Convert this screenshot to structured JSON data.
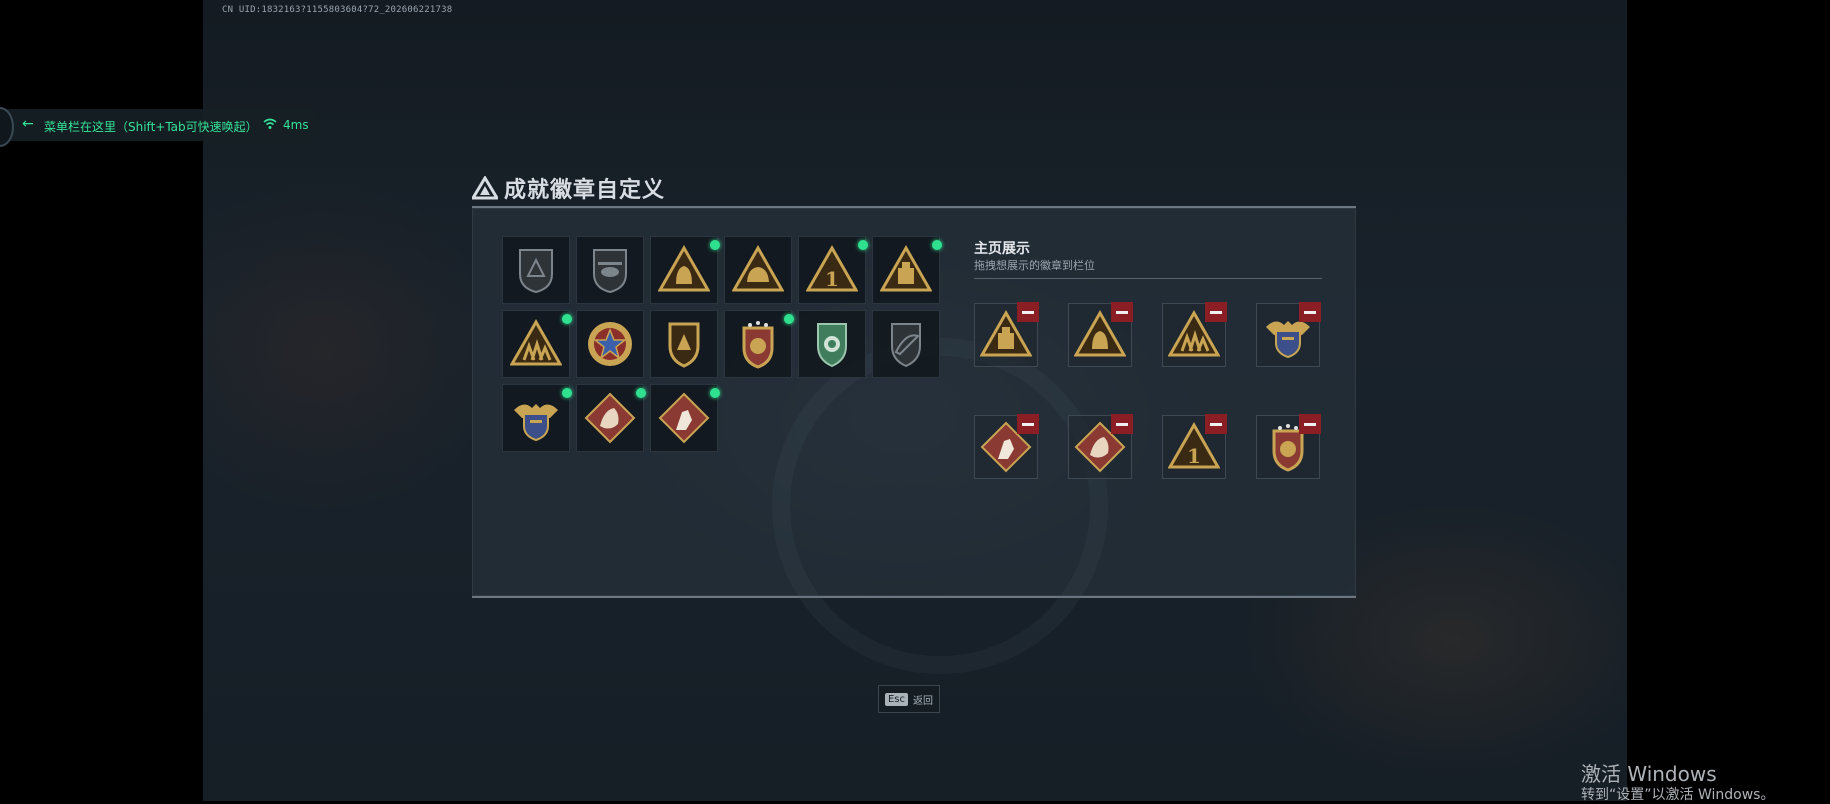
{
  "uid_text": "CN UID:1832163?1155803604?72_202606221738",
  "menu": {
    "label": "菜单栏在这里（Shift+Tab可快速唤起）",
    "ping": "4ms"
  },
  "dialog": {
    "title": "成就徽章自定义",
    "showcase": {
      "heading": "主页展示",
      "subtitle": "拖拽想展示的徽章到栏位"
    }
  },
  "badges": [
    {
      "icon": "grey-shield-badge-icon",
      "new": false
    },
    {
      "icon": "grey-helicopter-badge-icon",
      "new": false
    },
    {
      "icon": "gold-bag-triangle-badge-icon",
      "new": true
    },
    {
      "icon": "gold-helmet-triangle-badge-icon",
      "new": false
    },
    {
      "icon": "number-one-triangle-badge-icon",
      "new": true
    },
    {
      "icon": "gold-crate-triangle-badge-icon",
      "new": true
    },
    {
      "icon": "soldiers-triangle-badge-icon",
      "new": true
    },
    {
      "icon": "star-wreath-badge-icon",
      "new": false
    },
    {
      "icon": "gold-shield-emblem-badge-icon",
      "new": false
    },
    {
      "icon": "starred-crest-badge-icon",
      "new": true
    },
    {
      "icon": "green-shield-badge-icon",
      "new": false
    },
    {
      "icon": "grey-wing-shield-badge-icon",
      "new": false
    },
    {
      "icon": "winged-crest-badge-icon",
      "new": true
    },
    {
      "icon": "dragon-diamond-badge-icon",
      "new": true
    },
    {
      "icon": "soldier-diamond-badge-icon",
      "new": true
    }
  ],
  "showcase_slots": [
    {
      "icon": "gold-crate-triangle-badge-icon"
    },
    {
      "icon": "gold-bag-triangle-badge-icon"
    },
    {
      "icon": "soldiers-triangle-badge-icon"
    },
    {
      "icon": "winged-crest-badge-icon"
    },
    {
      "icon": "soldier-diamond-badge-icon"
    },
    {
      "icon": "dragon-diamond-badge-icon"
    },
    {
      "icon": "number-one-triangle-badge-icon"
    },
    {
      "icon": "starred-crest-badge-icon"
    }
  ],
  "esc": {
    "key": "Esc",
    "label": "返回"
  },
  "activation": {
    "title": "激活 Windows",
    "subtitle": "转到“设置”以激活 Windows。"
  }
}
